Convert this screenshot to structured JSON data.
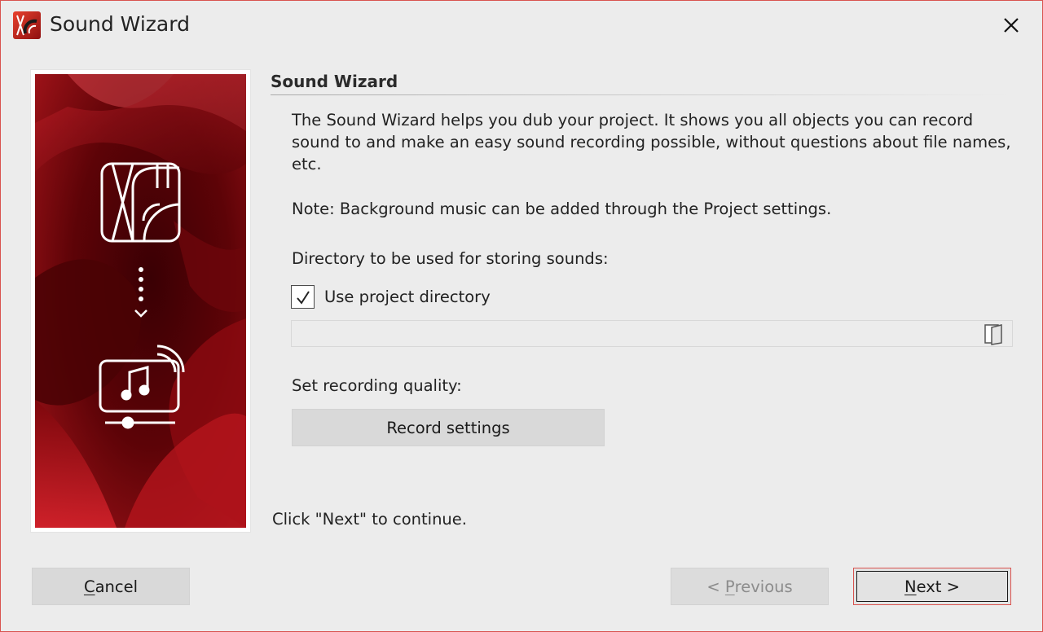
{
  "window": {
    "title": "Sound Wizard"
  },
  "section": {
    "title": "Sound Wizard"
  },
  "description": "The Sound Wizard helps you dub your project. It shows you all objects you can record sound to and make an easy sound recording possible, without questions about file names, etc.",
  "note": "Note: Background music can be added through the Project settings.",
  "directory": {
    "label": "Directory to be used for storing sounds:",
    "use_project_directory": {
      "label": "Use project directory",
      "checked": true
    },
    "path_value": ""
  },
  "quality": {
    "label": "Set recording quality:",
    "button_label": "Record settings"
  },
  "continue_hint": "Click \"Next\" to continue.",
  "buttons": {
    "cancel": {
      "accel": "C",
      "rest": "ancel"
    },
    "previous": {
      "prefix": "< ",
      "accel": "P",
      "rest": "revious",
      "enabled": false
    },
    "next": {
      "accel": "N",
      "rest": "ext >"
    }
  },
  "colors": {
    "accent_red": "#d9534f",
    "panel_red": "#8b0a0e",
    "button_gray": "#d9d9d9"
  },
  "icons": [
    "app-logo-icon",
    "close-icon",
    "photo-logo-icon",
    "dotted-arrow-down-icon",
    "music-broadcast-icon",
    "checkmark-icon",
    "folder-browse-icon"
  ]
}
